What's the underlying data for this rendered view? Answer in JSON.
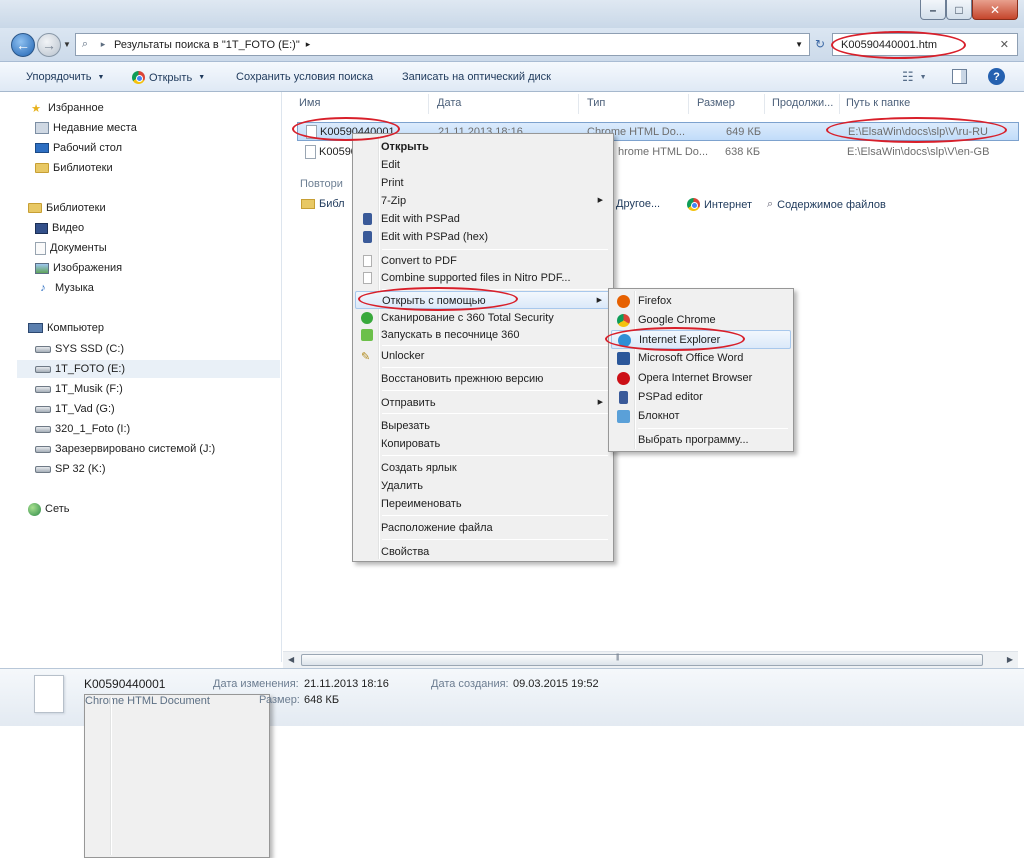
{
  "address": {
    "path": "Результаты поиска в \"1T_FOTO (E:)\"",
    "separator": "▸"
  },
  "search": {
    "value": "K00590440001.htm",
    "clear": "✕"
  },
  "toolbar": {
    "organize": "Упорядочить",
    "open": "Открыть",
    "save_search": "Сохранить условия поиска",
    "burn": "Записать на оптический диск",
    "help": "?"
  },
  "sidebar": {
    "favorites": "Избранное",
    "recent": "Недавние места",
    "desktop": "Рабочий стол",
    "libraries_fav": "Библиотеки",
    "libraries": "Библиотеки",
    "video": "Видео",
    "documents": "Документы",
    "images": "Изображения",
    "music": "Музыка",
    "computer": "Компьютер",
    "drives": [
      "SYS SSD (C:)",
      "1T_FOTO (E:)",
      "1T_Musik (F:)",
      "1T_Vad (G:)",
      "320_1_Foto (I:)",
      "Зарезервировано системой (J:)",
      "SP 32 (K:)"
    ],
    "network": "Сеть"
  },
  "columns": [
    "Имя",
    "Дата",
    "Тип",
    "Размер",
    "Продолжи...",
    "Путь к папке"
  ],
  "files": [
    {
      "name": "K00590440001",
      "date": "21.11.2013 18:16",
      "type": "Chrome HTML Do...",
      "size": "649 КБ",
      "path": "E:\\ElsaWin\\docs\\slp\\V\\ru-RU"
    },
    {
      "name": "K00590",
      "date": "",
      "type": "hrome HTML Do...",
      "size": "638 КБ",
      "path": "E:\\ElsaWin\\docs\\slp\\V\\en-GB"
    }
  ],
  "search_again": {
    "label": "Повтори",
    "lib": "Библ",
    "other": "Другое...",
    "internet": "Интернет",
    "contents": "Содержимое файлов"
  },
  "context_menu": {
    "open": "Открыть",
    "edit": "Edit",
    "print": "Print",
    "zip": "7-Zip",
    "edit_pspad": "Edit with PSPad",
    "edit_pspad_hex": "Edit with PSPad (hex)",
    "convert_pdf": "Convert to PDF",
    "combine_nitro": "Combine supported files in Nitro PDF...",
    "open_with": "Открыть с помощью",
    "scan_360": "Сканирование с 360 Total Security",
    "sandbox_360": "Запускать в песочнице 360",
    "unlocker": "Unlocker",
    "restore": "Восстановить прежнюю версию",
    "send_to": "Отправить",
    "cut": "Вырезать",
    "copy": "Копировать",
    "shortcut": "Создать ярлык",
    "delete": "Удалить",
    "rename": "Переименовать",
    "file_location": "Расположение файла",
    "properties": "Свойства"
  },
  "open_with_menu": [
    {
      "label": "Firefox",
      "icon": "firefox-icon",
      "color": "#e66000"
    },
    {
      "label": "Google Chrome",
      "icon": "chrome-icon",
      "color": "#db4437"
    },
    {
      "label": "Internet Explorer",
      "icon": "ie-icon",
      "color": "#2f8fd6"
    },
    {
      "label": "Microsoft Office Word",
      "icon": "word-icon",
      "color": "#2b579a"
    },
    {
      "label": "Opera Internet Browser",
      "icon": "opera-icon",
      "color": "#cc0f16"
    },
    {
      "label": "PSPad editor",
      "icon": "pspad-icon",
      "color": "#3a5a99"
    },
    {
      "label": "Блокнот",
      "icon": "notepad-icon",
      "color": "#5aa0d8"
    },
    {
      "label": "Выбрать программу...",
      "icon": "",
      "color": ""
    }
  ],
  "details": {
    "filename": "K00590440001",
    "filetype": "Chrome HTML Document",
    "modified_label": "Дата изменения:",
    "modified": "21.11.2013 18:16",
    "created_label": "Дата создания:",
    "created": "09.03.2015 19:52",
    "size_label": "Размер:",
    "size": "648 КБ"
  },
  "colors": {
    "annotation": "#d81f2a",
    "selection": "#c1dcf9",
    "menu_highlight": "#dbe9f9"
  }
}
